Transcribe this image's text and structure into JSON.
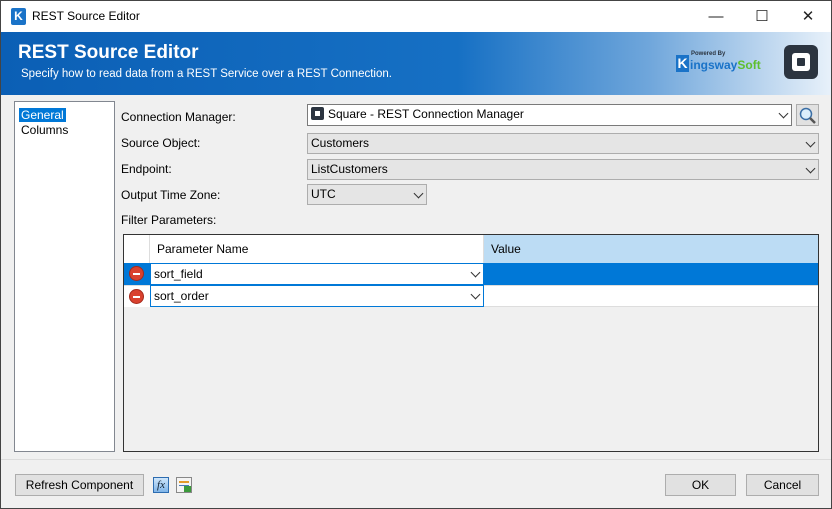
{
  "window": {
    "title": "REST Source Editor",
    "app_icon": "K"
  },
  "banner": {
    "title": "REST Source Editor",
    "subtitle": "Specify how to read data from a REST Service over a REST Connection.",
    "logo_powered": "Powered By",
    "logo_brand": "KingswaySoft",
    "accent": "#0b5fb5"
  },
  "nav": {
    "items": [
      {
        "label": "General",
        "selected": true
      },
      {
        "label": "Columns",
        "selected": false
      }
    ]
  },
  "form": {
    "connection_manager": {
      "label": "Connection Manager:",
      "value": "Square - REST Connection Manager"
    },
    "source_object": {
      "label": "Source Object:",
      "value": "Customers"
    },
    "endpoint": {
      "label": "Endpoint:",
      "value": "ListCustomers"
    },
    "time_zone": {
      "label": "Output Time Zone:",
      "value": "UTC"
    },
    "filter_label": "Filter Parameters:"
  },
  "grid": {
    "columns": [
      "Parameter Name",
      "Value"
    ],
    "rows": [
      {
        "name": "sort_field",
        "value": "",
        "selected": true
      },
      {
        "name": "sort_order",
        "value": "",
        "selected": false
      }
    ]
  },
  "footer": {
    "refresh": "Refresh Component",
    "fx": "fx",
    "ok": "OK",
    "cancel": "Cancel"
  }
}
